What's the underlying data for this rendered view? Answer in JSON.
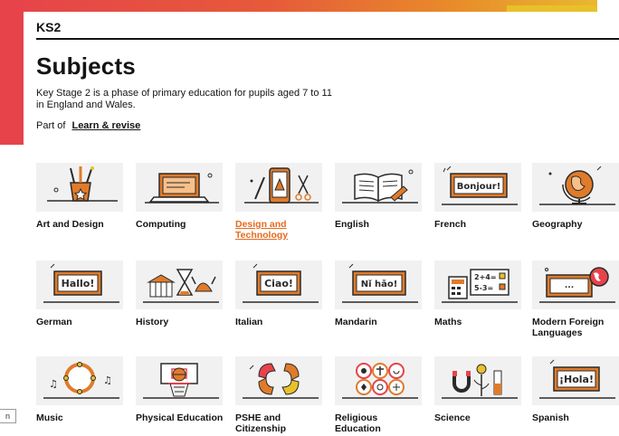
{
  "header": {
    "section": "KS2",
    "title": "Subjects",
    "intro": "Key Stage 2 is a phase of primary education for pupils aged 7 to 11 in England and Wales.",
    "part_of_prefix": "Part of",
    "part_of_link": "Learn & revise"
  },
  "subjects": [
    {
      "label": "Art and Design",
      "icon": "art-and-design-icon"
    },
    {
      "label": "Computing",
      "icon": "computing-icon"
    },
    {
      "label": "Design and Technology",
      "icon": "design-and-technology-icon"
    },
    {
      "label": "English",
      "icon": "english-icon"
    },
    {
      "label": "French",
      "icon": "french-icon",
      "sign": "Bonjour!"
    },
    {
      "label": "Geography",
      "icon": "geography-icon"
    },
    {
      "label": "German",
      "icon": "german-icon",
      "sign": "Hallo!"
    },
    {
      "label": "History",
      "icon": "history-icon"
    },
    {
      "label": "Italian",
      "icon": "italian-icon",
      "sign": "Ciao!"
    },
    {
      "label": "Mandarin",
      "icon": "mandarin-icon",
      "sign": "Nǐ hǎo!"
    },
    {
      "label": "Maths",
      "icon": "maths-icon",
      "sign1": "2+4=",
      "sign2": "5-3="
    },
    {
      "label": "Modern Foreign Languages",
      "icon": "modern-foreign-languages-icon",
      "sign": "..."
    },
    {
      "label": "Music",
      "icon": "music-icon"
    },
    {
      "label": "Physical Education",
      "icon": "physical-education-icon"
    },
    {
      "label": "PSHE and Citizenship",
      "icon": "pshe-and-citizenship-icon"
    },
    {
      "label": "Religious Education",
      "icon": "religious-education-icon"
    },
    {
      "label": "Science",
      "icon": "science-icon"
    },
    {
      "label": "Spanish",
      "icon": "spanish-icon",
      "sign": "¡Hola!"
    }
  ],
  "active_subject": "Design and Technology",
  "left_tab": "n",
  "colors": {
    "accent_red": "#e6434b",
    "accent_orange": "#e66a1e",
    "accent_yellow": "#e8c12a",
    "icon_orange": "#e07b2a",
    "icon_dark": "#2a2a2a",
    "tile_bg": "#f1f1f1"
  }
}
